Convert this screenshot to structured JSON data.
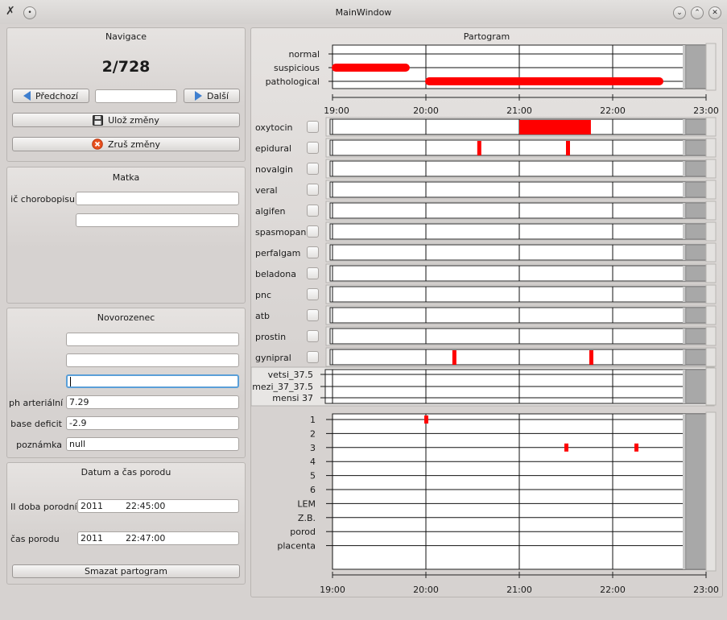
{
  "window": {
    "title": "MainWindow"
  },
  "navigace": {
    "title": "Navigace",
    "counter": "2/728",
    "prev_label": "Předchozí",
    "next_label": "Další",
    "record_value": "",
    "save_label": "Ulož změny",
    "cancel_label": "Zruš změny"
  },
  "matka": {
    "title": "Matka",
    "fields": [
      {
        "label": "ič chorobopisu",
        "value": ""
      },
      {
        "label": "",
        "value": ""
      }
    ]
  },
  "novorozenec": {
    "title": "Novorozenec",
    "fields": [
      {
        "label": "",
        "value": ""
      },
      {
        "label": "",
        "value": ""
      },
      {
        "label": "",
        "value": ""
      },
      {
        "label": "ph arteriální",
        "value": "7.29"
      },
      {
        "label": "base deficit",
        "value": "-2.9"
      },
      {
        "label": "poznámka",
        "value": "null"
      }
    ]
  },
  "datum": {
    "title": "Datum a čas porodu",
    "fields": [
      {
        "label": "II doba porodní",
        "value": "2011        22:45:00"
      },
      {
        "label": "čas porodu",
        "value": "2011        22:47:00"
      }
    ],
    "clear_label": "Smazat partogram"
  },
  "partogram": {
    "title": "Partogram",
    "time_ticks": [
      "19:00",
      "20:00",
      "21:00",
      "22:00",
      "23:00"
    ],
    "status_levels": [
      "normal",
      "suspicious",
      "pathological"
    ],
    "status_bars": [
      {
        "level": "suspicious",
        "start": "19:00",
        "end": "19:47"
      },
      {
        "level": "pathological",
        "start": "20:00",
        "end": "22:30"
      }
    ],
    "drugs": [
      {
        "name": "oxytocin",
        "marks": [
          {
            "start": "21:00",
            "end": "21:46"
          }
        ]
      },
      {
        "name": "epidural",
        "marks": [
          {
            "start": "20:33",
            "end": "20:35"
          },
          {
            "start": "21:30",
            "end": "21:32"
          }
        ]
      },
      {
        "name": "novalgin",
        "marks": []
      },
      {
        "name": "veral",
        "marks": []
      },
      {
        "name": "algifen",
        "marks": []
      },
      {
        "name": "spasmopan",
        "marks": []
      },
      {
        "name": "perfalgam",
        "marks": []
      },
      {
        "name": "beladona",
        "marks": []
      },
      {
        "name": "pnc",
        "marks": []
      },
      {
        "name": "atb",
        "marks": []
      },
      {
        "name": "prostin",
        "marks": []
      },
      {
        "name": "gynipral",
        "marks": [
          {
            "start": "20:17",
            "end": "20:19"
          },
          {
            "start": "21:45",
            "end": "21:47"
          }
        ]
      }
    ],
    "temp_levels": [
      "vetsi_37.5",
      "mezi_37_37.5",
      "mensi  37"
    ],
    "cervix_levels": [
      "1",
      "2",
      "3",
      "4",
      "5",
      "6",
      "LEM",
      "Z.B.",
      "porod",
      "placenta"
    ],
    "cervix_points": [
      {
        "time": "20:00",
        "level": "1"
      },
      {
        "time": "21:30",
        "level": "3"
      },
      {
        "time": "22:15",
        "level": "3"
      }
    ],
    "shaded_from": "22:45",
    "shaded_inner_from": "22:47",
    "colors": {
      "mark": "#ff0000",
      "shade": "#a8a8a8"
    }
  }
}
